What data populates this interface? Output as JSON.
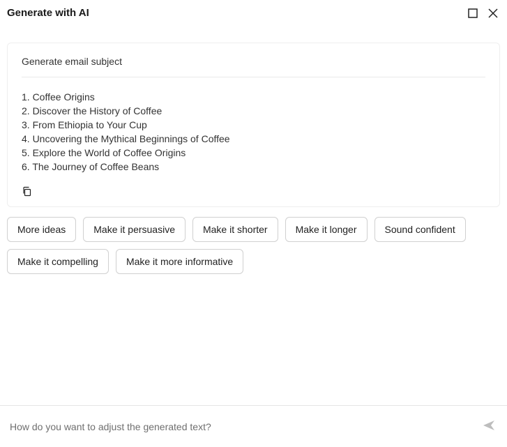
{
  "header": {
    "title": "Generate with AI"
  },
  "card": {
    "title": "Generate email subject",
    "items": [
      "1. Coffee Origins",
      "2. Discover the History of Coffee",
      "3. From Ethiopia to Your Cup",
      "4. Uncovering the Mythical Beginnings of Coffee",
      "5. Explore the World of Coffee Origins",
      "6. The Journey of Coffee Beans"
    ]
  },
  "chips": [
    "More ideas",
    "Make it persuasive",
    "Make it shorter",
    "Make it longer",
    "Sound confident",
    "Make it compelling",
    "Make it more informative"
  ],
  "footer": {
    "placeholder": "How do you want to adjust the generated text?"
  }
}
